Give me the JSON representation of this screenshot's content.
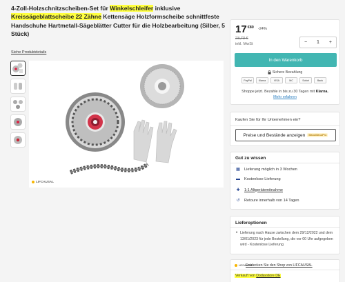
{
  "product": {
    "title_part1": "4-Zoll-Holzschnitzscheiben-Set für ",
    "title_highlight1": "Winkelschleifer",
    "title_part2": " inklusive ",
    "title_highlight2": "Kreissägeblattscheibe 22 Zähne",
    "title_part3": " Kettensäge Holzformscheibe schnittfeste Handschuhe Hartmetall-Sägeblätter Cutter für die Holzbearbeitung (Silber, 5 Stück)",
    "details_link": "Siehe Produktdetails",
    "brand_watermark": "LIFCAUSAL"
  },
  "buy_box": {
    "price_main": "17",
    "price_cents": "€80",
    "discount": "-24%",
    "price_old": "23,73 €",
    "tax_note": "inkl. MwSt",
    "qty_minus": "−",
    "qty_value": "1",
    "qty_plus": "+",
    "cart_button": "In den Warenkorb",
    "secure_payment": "Sichere Bezahlung",
    "payment_methods": [
      "PayPal",
      "Klarna",
      "VISA",
      "MC",
      "Sofort",
      "Bank"
    ],
    "klarna_text": "Shoppe jetzt. Bezahle in bis zu 30 Tagen mit",
    "klarna_brand": "Klarna.",
    "klarna_more": "Mehr erfahren"
  },
  "b2b": {
    "question": "Kaufen Sie für Ihr Unternehmen ein?",
    "button": "Preise und Bestände anzeigen",
    "button_logo": "ManoManoPro"
  },
  "good_to_know": {
    "title": "Gut zu wissen",
    "items": [
      {
        "icon": "calendar-icon",
        "text": "Lieferung möglich in 3 Wochen"
      },
      {
        "icon": "truck-icon",
        "text": "Kostenlose Lieferung"
      },
      {
        "icon": "puzzle-icon",
        "text": "1:1 Altgerätemitnahme"
      },
      {
        "icon": "return-icon",
        "text": "Retoure innerhalb von 14 Tagen"
      }
    ]
  },
  "delivery": {
    "title": "Lieferoptionen",
    "text": "Lieferung nach Hause zwischen dem 29/12/2022 und dem 13/01/2023 für jede Bestellung, die vor 00 Uhr aufgegeben wird - Kostenlose Lieferung"
  },
  "seller": {
    "logo": "LIFCAUSAL",
    "shop_link": "Entdecken Sie den Shop von LIFCAUSAL",
    "sold_by_prefix": "Verkauft von ",
    "sold_by_name": "Dodavstore DE"
  }
}
